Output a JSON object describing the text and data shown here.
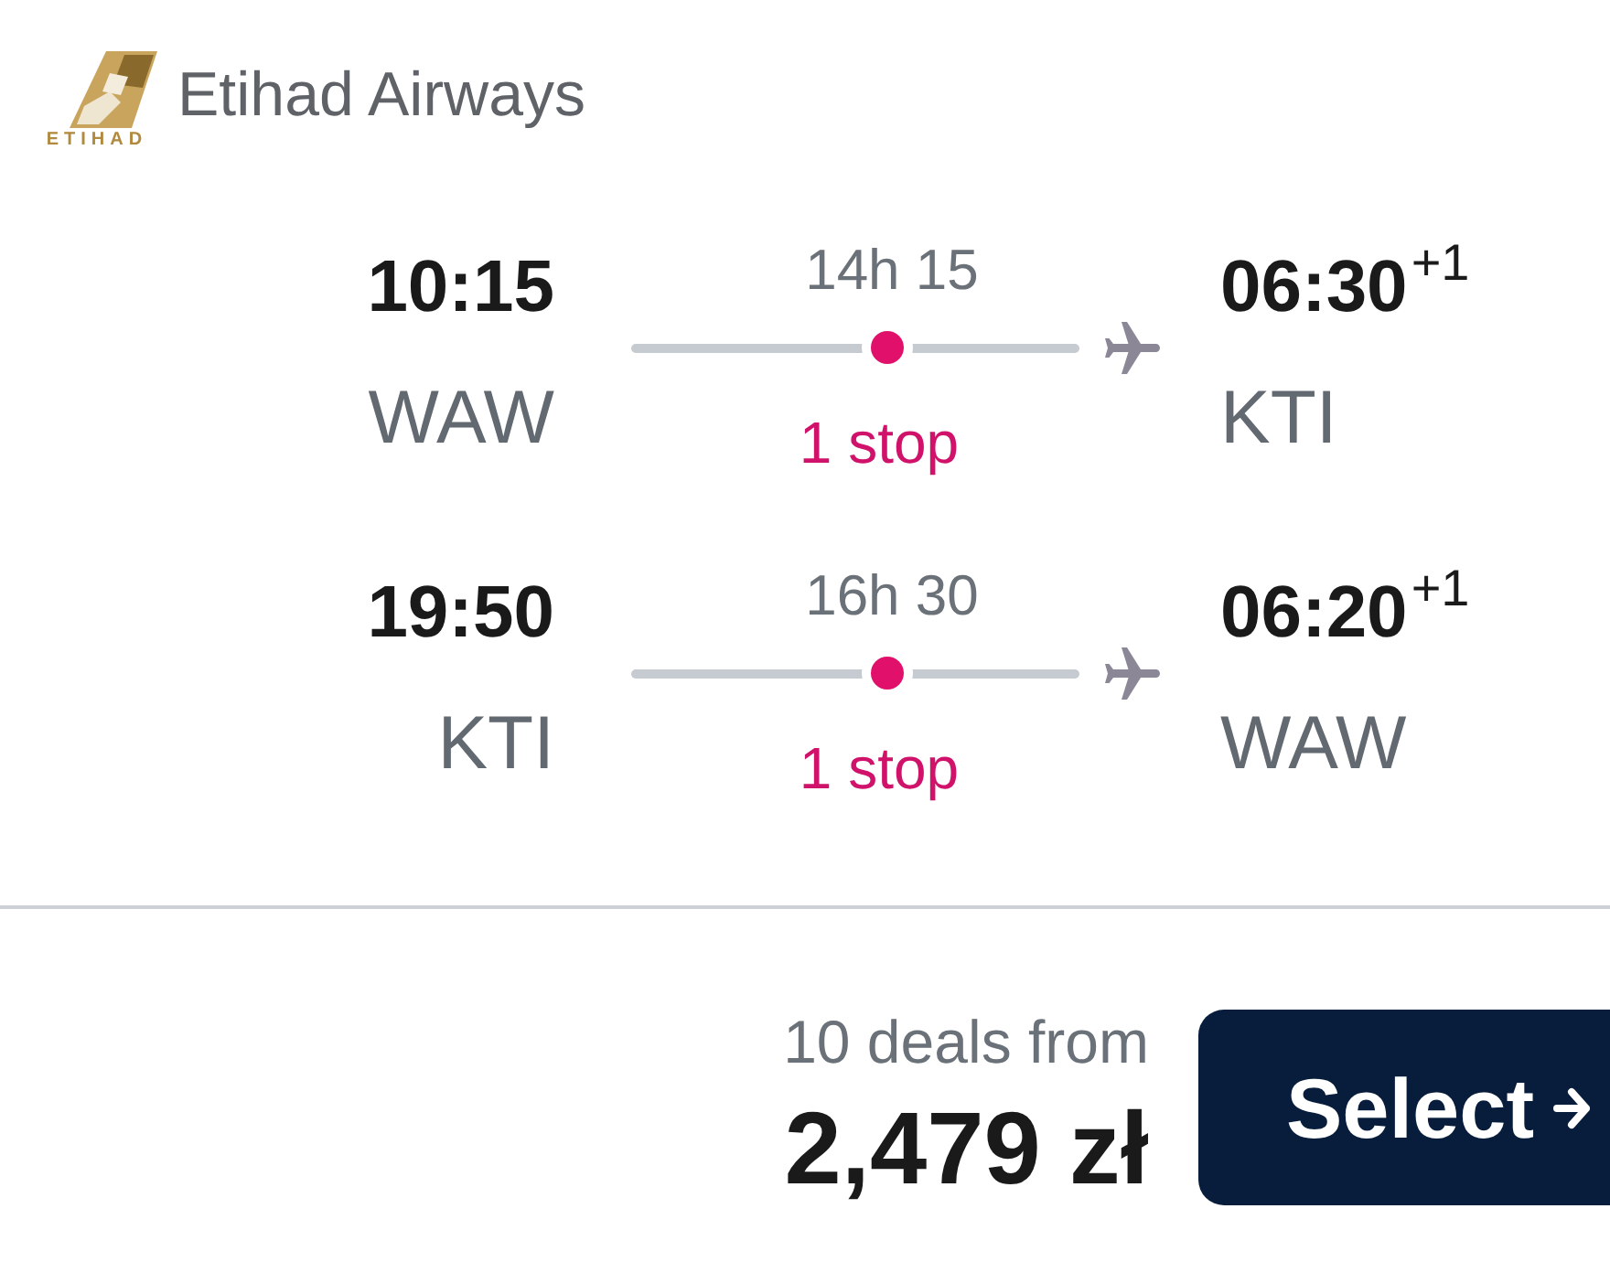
{
  "airline": {
    "name": "Etihad Airways",
    "logo_text": "ETIHAD"
  },
  "legs": [
    {
      "departure_time": "10:15",
      "departure_airport": "WAW",
      "duration": "14h 15",
      "stops": "1 stop",
      "arrival_time": "06:30",
      "day_offset": "+1",
      "arrival_airport": "KTI"
    },
    {
      "departure_time": "19:50",
      "departure_airport": "KTI",
      "duration": "16h 30",
      "stops": "1 stop",
      "arrival_time": "06:20",
      "day_offset": "+1",
      "arrival_airport": "WAW"
    }
  ],
  "price": {
    "deals": "10 deals from",
    "amount": "2,479 zł"
  },
  "select_button": {
    "label": "Select"
  }
}
